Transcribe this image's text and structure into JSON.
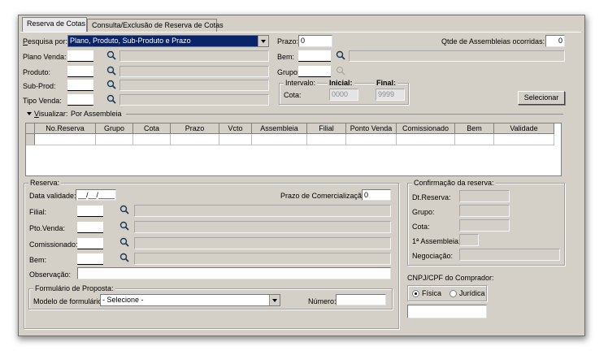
{
  "tabs": [
    {
      "label": "Reserva de Cotas",
      "active": true
    },
    {
      "label": "Consulta/Exclusão de Reserva de Cotas",
      "active": false
    }
  ],
  "search": {
    "pesquisa_label_u": "P",
    "pesquisa_label_rest": "esquisa por:",
    "pesquisa_value": "Plano, Produto, Sub-Produto e Prazo",
    "plano_venda_label": "Plano Venda:",
    "produto_label": "Produto:",
    "sub_prod_label": "Sub-Prod:",
    "tipo_venda_label": "Tipo Venda:",
    "prazo_label": "Prazo:",
    "prazo_value": "0",
    "qtde_label": "Qtde de Assembleias ocorridas:",
    "qtde_value": "0",
    "bem_label": "Bem:",
    "grupo_label": "Grupo:",
    "intervalo_label": "Intervalo:",
    "inicial_label": "Inicial:",
    "final_label": "Final:",
    "cota_label": "Cota:",
    "inicial_value": "0000",
    "final_value": "9999",
    "selecionar_label": "Selecionar"
  },
  "visualizar": {
    "label_u": "V",
    "label_rest": "isualizar:",
    "value": "Por Assembleia"
  },
  "grid": {
    "columns": [
      "No.Reserva",
      "Grupo",
      "Cota",
      "Prazo",
      "Vcto",
      "Assembleia",
      "Filial",
      "Ponto Venda",
      "Comissionado",
      "Bem",
      "Validade"
    ]
  },
  "reserva": {
    "title": "Reserva:",
    "data_validade_label": "Data validade:",
    "data_validade_value": "__/__/____",
    "prazo_comerc_label": "Prazo de Comercialização:",
    "prazo_comerc_value": "0",
    "filial_label": "Filial:",
    "pto_venda_label": "Pto.Venda:",
    "comissionado_label": "Comissionado:",
    "bem_label": "Bem:",
    "observacao_label": "Observação:"
  },
  "formulario": {
    "title": "Formulário de Proposta:",
    "modelo_label": "Modelo de formulário:",
    "modelo_value": "- Selecione -",
    "numero_label": "Número:"
  },
  "confirmacao": {
    "title": "Confirmação da reserva:",
    "dt_reserva_label": "Dt.Reserva:",
    "grupo_label": "Grupo:",
    "cota_label": "Cota:",
    "primeira_assembleia_label": "1ª Assembleia:",
    "negociacao_label": "Negociação:"
  },
  "cnpj": {
    "title": "CNPJ/CPF do Comprador:",
    "fisica_label": "Física",
    "juridica_label": "Jurídica",
    "selected": "Física"
  }
}
